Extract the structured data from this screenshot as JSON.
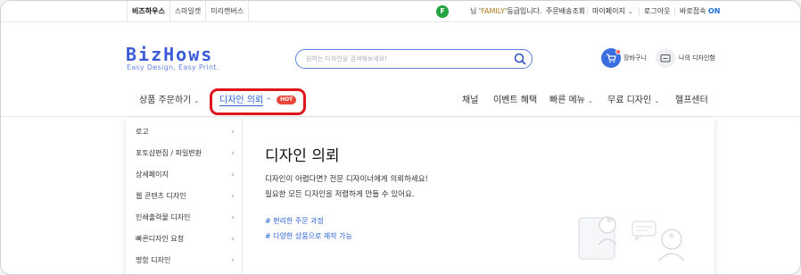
{
  "topbar": {
    "tabs": [
      "비즈하우스",
      "스마일캣",
      "미리캔버스"
    ],
    "grade_badge": "F",
    "greeting_prefix": "님 '",
    "grade_name": "FAMILY",
    "greeting_suffix": "'등급입니다.",
    "links": {
      "orders": "주문배송조회",
      "mypage": "마이페이지",
      "logout": "로그아웃",
      "quick_access": "바로접속",
      "quick_access_state": "ON"
    }
  },
  "header": {
    "logo_main": "BizHows",
    "slogan": "Easy Design, Easy Print.",
    "search_placeholder": "원하는 디자인을 검색해보세요!",
    "cart_label": "장바구니",
    "my_design_label": "나의 디자인함"
  },
  "nav": {
    "order_products": "상품 주문하기",
    "design_request": "디자인 의뢰",
    "hot_badge": "HOT",
    "channel": "채널",
    "events": "이벤트 혜택",
    "quick_menu": "빠른 메뉴",
    "free_design": "무료 디자인",
    "help_center": "헬프센터"
  },
  "dropdown": {
    "sidebar": [
      "로고",
      "포토샵편집 / 파일변환",
      "상세페이지",
      "웹 콘텐츠 디자인",
      "인쇄출력물 디자인",
      "빠른디자인 요청",
      "명함 디자인"
    ],
    "title": "디자인 의뢰",
    "desc_line1": "디자인이 어렵다면? 전문 디자이너에게 의뢰하세요!",
    "desc_line2": "필요한 모든 디자인을 저렴하게 만들 수 있어요.",
    "links": [
      "# 편리한 주문 과정",
      "# 다양한 상품으로 제작 가능"
    ]
  },
  "colors": {
    "brand_blue": "#3b5bd8",
    "link_blue": "#2b63d6",
    "hot_red": "#e8463a",
    "highlight_red": "#e0141c",
    "grade_green": "#22a441"
  }
}
